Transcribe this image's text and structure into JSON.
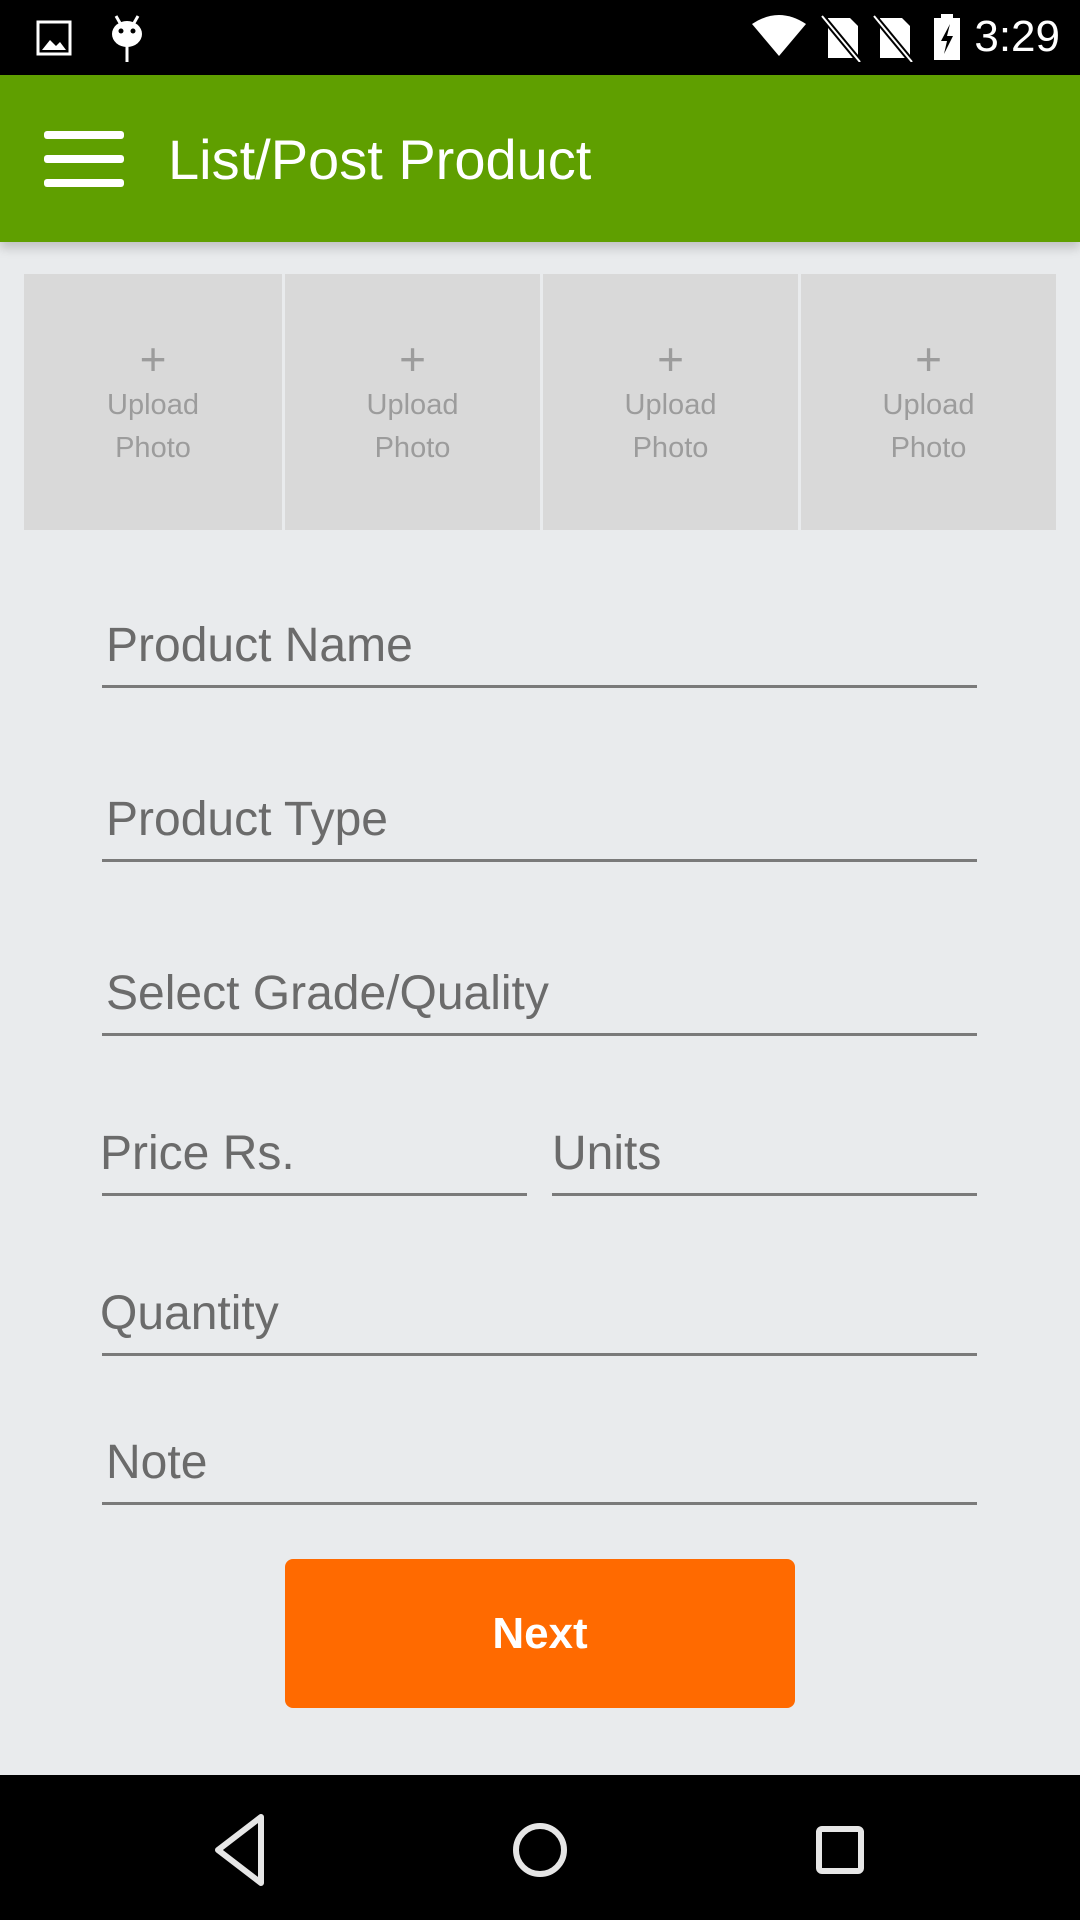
{
  "status_bar": {
    "time": "3:29",
    "icons": [
      "image-notification-icon",
      "android-debug-icon",
      "wifi-icon",
      "no-sim-icon",
      "no-sim-icon",
      "battery-charging-icon"
    ]
  },
  "app_bar": {
    "title": "List/Post Product",
    "menu_icon": "hamburger-menu-icon",
    "color": "#5f9f00"
  },
  "photos": [
    {
      "icon": "+",
      "label": "Upload\nPhoto"
    },
    {
      "icon": "+",
      "label": "Upload\nPhoto"
    },
    {
      "icon": "+",
      "label": "Upload\nPhoto"
    },
    {
      "icon": "+",
      "label": "Upload\nPhoto"
    }
  ],
  "form": {
    "product_name": {
      "placeholder": "Product Name",
      "value": ""
    },
    "product_type": {
      "placeholder": "Product Type",
      "value": ""
    },
    "grade": {
      "placeholder": "Select Grade/Quality",
      "value": ""
    },
    "price": {
      "placeholder": "Price Rs.",
      "value": ""
    },
    "units": {
      "placeholder": "Units",
      "value": ""
    },
    "quantity": {
      "placeholder": "Quantity",
      "value": ""
    },
    "note": {
      "placeholder": "Note",
      "value": ""
    }
  },
  "next_button": {
    "label": "Next",
    "color": "#ff6a00"
  },
  "nav_bar": {
    "back": "back-icon",
    "home": "home-icon",
    "recents": "recents-icon"
  }
}
